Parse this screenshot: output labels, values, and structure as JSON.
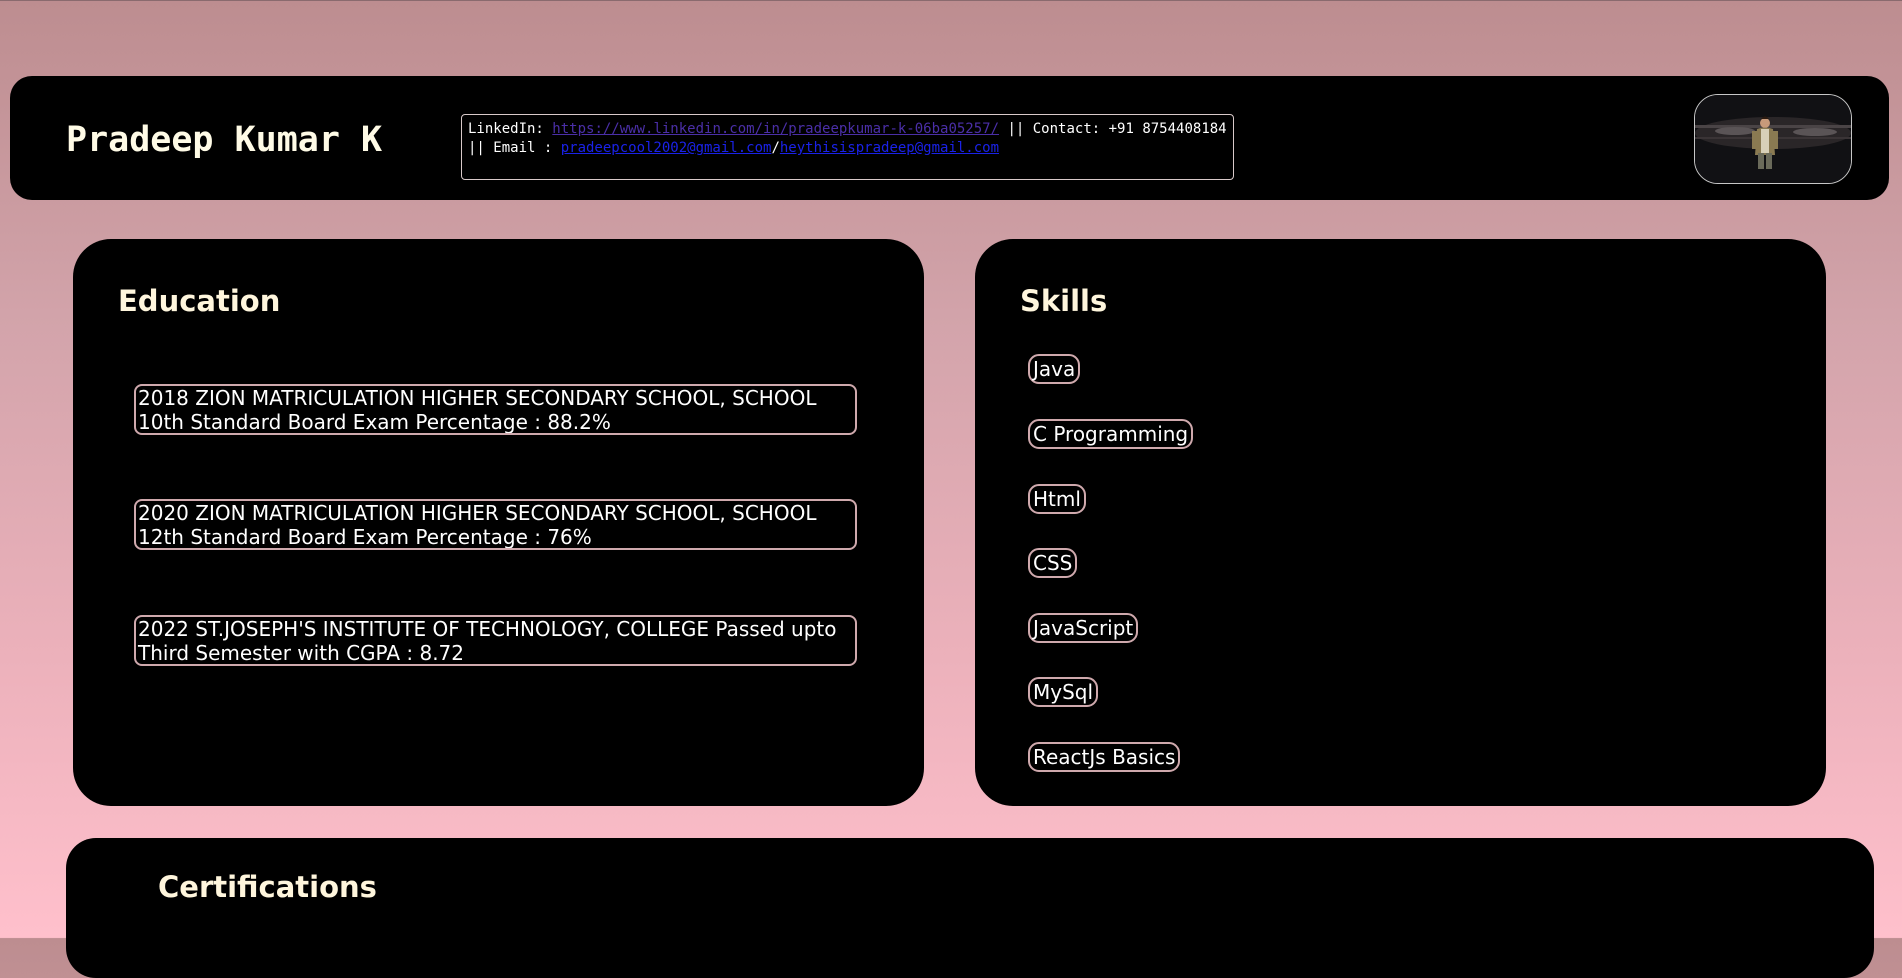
{
  "header": {
    "name": "Pradeep Kumar K",
    "contact": {
      "linkedin_label": "LinkedIn: ",
      "linkedin_url": "https://www.linkedin.com/in/pradeepkumar-k-06ba05257/",
      "contact_label": " || Contact: +91 8754408184 || Email : ",
      "email_1": "pradeepcool2002@gmail.com",
      "email_separator": "/",
      "email_2": "heythisispradeep@gmail.com"
    }
  },
  "education": {
    "title": "Education",
    "items": [
      {
        "line1": "2018 ZION MATRICULATION HIGHER SECONDARY SCHOOL, SCHOOL",
        "line2": "10th Standard Board Exam Percentage : 88.2%"
      },
      {
        "line1": "2020 ZION MATRICULATION HIGHER SECONDARY SCHOOL, SCHOOL",
        "line2": "12th Standard Board Exam Percentage : 76%"
      },
      {
        "line1": "2022 ST.JOSEPH'S INSTITUTE OF TECHNOLOGY, COLLEGE Passed upto",
        "line2": "Third Semester with CGPA : 8.72"
      }
    ]
  },
  "skills": {
    "title": "Skills",
    "items": [
      "Java",
      "C Programming",
      "Html",
      "CSS",
      "JavaScript",
      "MySql",
      "ReactJs Basics"
    ]
  },
  "certifications": {
    "title": "Certifications"
  },
  "colors": {
    "panel_bg": "#000000",
    "title_text": "#fff6dd",
    "item_border": "#cfa9ad",
    "link_visited": "#4b2fa8",
    "link_email": "#1a22e8"
  }
}
